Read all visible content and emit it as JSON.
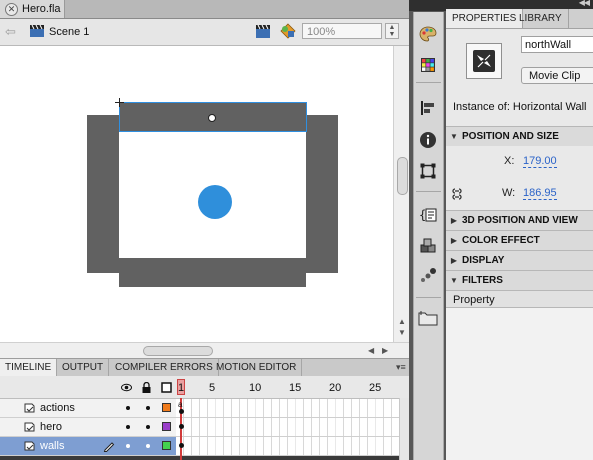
{
  "document": {
    "tab_title": "Hero.fla",
    "close_glyph": "✕"
  },
  "edit_bar": {
    "back_glyph": "⇦",
    "scene_label": "Scene 1",
    "zoom_value": "100%",
    "stepper_up": "▲",
    "stepper_down": "▼"
  },
  "scrollbars": {
    "left_arrow": "◀",
    "right_arrow": "▶",
    "up_arrow": "▲",
    "down_arrow": "▼"
  },
  "timeline": {
    "tabs": [
      {
        "label": "TIMELINE",
        "active": true
      },
      {
        "label": "OUTPUT",
        "active": false
      },
      {
        "label": "COMPILER ERRORS",
        "active": false
      },
      {
        "label": "MOTION EDITOR",
        "active": false
      }
    ],
    "menu_glyph": "▾≡",
    "frame_numbers": [
      "1",
      "5",
      "10",
      "15",
      "20",
      "25"
    ],
    "layers": [
      {
        "name": "actions",
        "color": "#f07b1c",
        "selected": false,
        "keyframe_label": "a"
      },
      {
        "name": "hero",
        "color": "#9a3ec9",
        "selected": false,
        "keyframe_label": ""
      },
      {
        "name": "walls",
        "color": "#43d14d",
        "selected": true,
        "keyframe_label": ""
      }
    ]
  },
  "tools": {
    "items": [
      "color-palette-icon",
      "swatches-grid-icon",
      "align-icon",
      "info-icon",
      "transform-icon",
      "code-snippets-icon",
      "components-icon",
      "motion-presets-icon",
      "project-folder-icon"
    ]
  },
  "panel": {
    "collapse_glyph": "◀◀",
    "tabs": [
      {
        "label": "PROPERTIES",
        "active": true
      },
      {
        "label": "LIBRARY",
        "active": false
      }
    ],
    "instance_name": "northWall",
    "symbol_type": "Movie Clip",
    "instance_of": "Instance of:  Horizontal Wall",
    "sections": {
      "position_size": "POSITION AND SIZE",
      "position_3d": "3D POSITION AND VIEW",
      "color_effect": "COLOR EFFECT",
      "display": "DISPLAY",
      "filters": "FILTERS"
    },
    "x_label": "X:",
    "x_value": "179.00",
    "w_label": "W:",
    "w_value": "186.95",
    "filters_column": "Property",
    "tri_open": "▼",
    "tri_closed": "▶"
  },
  "colors": {
    "wall": "#616161",
    "hero": "#2f8fdb",
    "selection": "#2f8fe0",
    "playhead": "#d03a3a"
  }
}
